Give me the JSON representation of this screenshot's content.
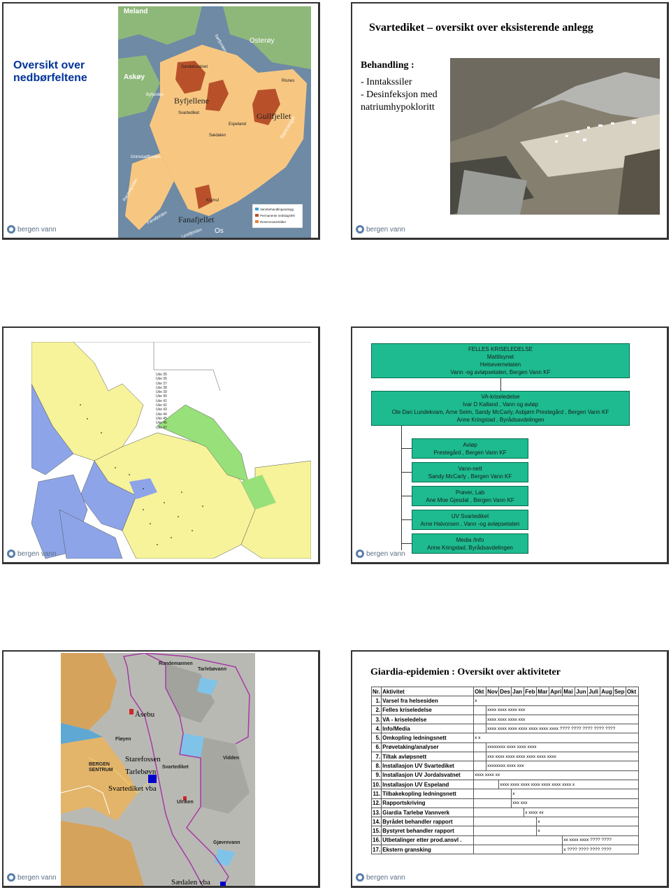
{
  "logo": {
    "text": "bergen vann"
  },
  "slide1": {
    "title": "Oversikt over nedbørfeltene",
    "map_labels": {
      "meland": "Meland",
      "osteroy": "Osterøy",
      "askoy": "Askøy",
      "byfjellene": "Byfjellene",
      "gullfjellet": "Gullfjellet",
      "fanafjellet": "Fanafjellet",
      "os": "Os",
      "svartediket": "Svartediket",
      "sandalsvatnet": "Sandalsvatnet",
      "espeland": "Espeland",
      "sadalen": "Sædalen",
      "kismul": "Kismul",
      "risnes": "Risnes",
      "byfjorden": "Byfjorden",
      "grimstadfjorden": "Grimstadfjorden",
      "sorfjorden": "Sørfjorden",
      "samnangerfjorden": "Samnanger",
      "raunefjorden": "Raunefjorden",
      "fanafjorden": "Fanafjorden",
      "lysefjorden": "Lysefjorden"
    },
    "legend": [
      {
        "label": "Vannbehandlingsanlegg",
        "color": "#3aa0d8"
      },
      {
        "label": "Permanente nedslagsfelt",
        "color": "#b8512a"
      },
      {
        "label": "Reservevannkilder",
        "color": "#e8822e"
      }
    ]
  },
  "slide2": {
    "title": "Svartediket – oversikt over eksisterende anlegg",
    "heading": "Behandling :",
    "items": [
      "- Inntakssiler",
      "- Desinfeksjon med natriumhypokloritt"
    ]
  },
  "slide3": {
    "legend": [
      "Uke 35",
      "Uke 36",
      "Uke 37",
      "Uke 38",
      "Uke 39",
      "Uke 40",
      "Uke 41",
      "Uke 42",
      "Uke 43",
      "Uke 44",
      "Uke 45",
      "Uke 46",
      "Uke 47"
    ]
  },
  "slide4": {
    "top": [
      "FELLES KRISELEDELSE",
      "Mattilsynet",
      "Helsevernetaten",
      "Vann -og avløpsetaten, Bergen Vann KF"
    ],
    "mid": [
      "VA-kriseledelse",
      "Ivar D Kalland , Vann og avløp",
      "Ole Dan Lundekvam, Arne Seim, Sandy McCarly, Asbjørn Prestegård , Bergen Vann KF",
      "Anne Kringstad , Byrådsavdelingen"
    ],
    "subs": [
      [
        "Avløp",
        "Prestegård , Bergen Vann KF"
      ],
      [
        "Vann-nett",
        "Sandy McCarly , Bergen Vann KF"
      ],
      [
        "Prøver, Lab",
        "Ane Moe Gjesdal , Bergen Vann KF"
      ],
      [
        "UV Svartediket",
        "Arne Halvorsen , Vann -og avløpsetaten"
      ],
      [
        "Media /Info",
        "Anne Kringstad, Byrådsavdelingen"
      ]
    ]
  },
  "slide5": {
    "labels": {
      "asebu": "Åsebu",
      "starefossen": "Starefossen",
      "tarlebovn": "Tarlebøvn",
      "svartediket_vba": "Svartediket vba",
      "sadalen_vba": "Sædalen vba"
    },
    "places": {
      "rundemannen": "Rundemannen",
      "tarlebovann": "Tarlebøvann",
      "floyen": "Fløyen",
      "bergen": "BERGEN",
      "sentrum": "SENTRUM",
      "svartediket": "Svartediket",
      "vidden": "Vidden",
      "ulriken": "Ulriken",
      "gjovrevann": "Gjøvrevann"
    }
  },
  "slide6": {
    "title": "Giardia-epidemien : Oversikt over aktiviteter",
    "headers": [
      "Nr.",
      "Aktivitet",
      "Okt",
      "Nov",
      "Des",
      "Jan",
      "Feb",
      "Mar",
      "Apri",
      "Mai",
      "Jun",
      "Juli",
      "Aug",
      "Sep",
      "Okt"
    ],
    "rows": [
      {
        "nr": "1.",
        "act": "Varsel fra helsesiden",
        "marks": "x"
      },
      {
        "nr": "2.",
        "act": "Felles kriseledelse",
        "marks": "xxxx xxxx xxxx xxx"
      },
      {
        "nr": "3.",
        "act": "VA - kriseledelse",
        "marks": "xxxx xxxx xxxx xxx"
      },
      {
        "nr": "4.",
        "act": "Info/Media",
        "marks": "xxxx xxxx xxxx xxxx xxxx xxxx xxxx ???? ???? ???? ???? ????"
      },
      {
        "nr": "5.",
        "act": "Omkopling ledningsnett",
        "marks": "x x"
      },
      {
        "nr": "6.",
        "act": "Prøvetaking/analyser",
        "marks": "xxxxxxxx xxxx xxxx xxxx"
      },
      {
        "nr": "7.",
        "act": "Tiltak avløpsnett",
        "marks": "xxx xxxx xxxx xxxx xxxx xxxx xxxx"
      },
      {
        "nr": "8.",
        "act": "Installasjon UV Svartediket",
        "marks": "xxxxxxxx xxxx xxx"
      },
      {
        "nr": "9.",
        "act": "Installasjon UV Jordalsvatnet",
        "marks": "xxxx xxxx xx"
      },
      {
        "nr": "10.",
        "act": "Installasjon UV Espeland",
        "marks": "xxxx xxxx xxxx xxxx xxxx xxxx xxxx x"
      },
      {
        "nr": "11.",
        "act": "Tilbakekopling ledningsnett",
        "marks": "x"
      },
      {
        "nr": "12.",
        "act": "Rapportskriving",
        "marks": "xxx xxx"
      },
      {
        "nr": "13.",
        "act": "Giardia Tarlebø Vannverk",
        "marks": "x xxxx xx"
      },
      {
        "nr": "14.",
        "act": "Byrådet behandler rapport",
        "marks": "x"
      },
      {
        "nr": "15.",
        "act": "Bystyret behandler rapport",
        "marks": "x"
      },
      {
        "nr": "16.",
        "act": "Utbetalinger etter prod.ansvl .",
        "marks": "xx xxxx xxxx ???? ????"
      },
      {
        "nr": "17.",
        "act": "Ekstern gransking",
        "marks": "x ???? ???? ???? ????"
      }
    ],
    "offsets": [
      0,
      1,
      1,
      1,
      0,
      1,
      1,
      1,
      0,
      2,
      3,
      3,
      4,
      5,
      5,
      7,
      7
    ]
  }
}
